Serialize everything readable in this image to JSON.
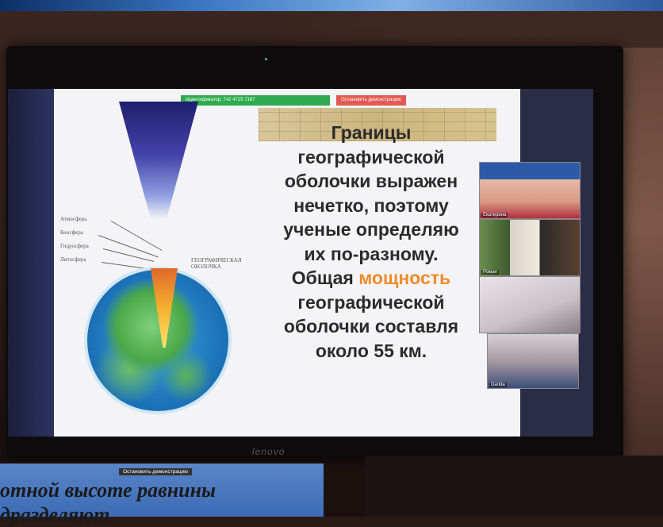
{
  "zoom_share": {
    "meeting_id": "Идентификатор: 742 4725 7167",
    "stop_button": "Остановить демонстрацию"
  },
  "slide": {
    "layers": [
      "Атмосфера",
      "Биосфера",
      "Гидросфера",
      "Литосфера"
    ],
    "geo_label": "Географическая оболочка",
    "text_lines": [
      "Границы",
      "географической",
      "оболочки выражен",
      "нечетко, поэтому",
      "ученые определяю",
      "их по-разному."
    ],
    "text_line7_prefix": "Общая ",
    "text_line7_highlight": "мощность",
    "text_lines_after": [
      "географической",
      "оболочки составля",
      "около 55 км."
    ],
    "highlight_color": "#f08a2a"
  },
  "participants": [
    "Екатерина",
    "Роман",
    "",
    "Darida"
  ],
  "monitor_brand": "lenovo",
  "bottom_screen": {
    "stop_button": "Остановить демонстрацию",
    "line1": "отной высоте равнины",
    "line2": "дразделяют"
  }
}
